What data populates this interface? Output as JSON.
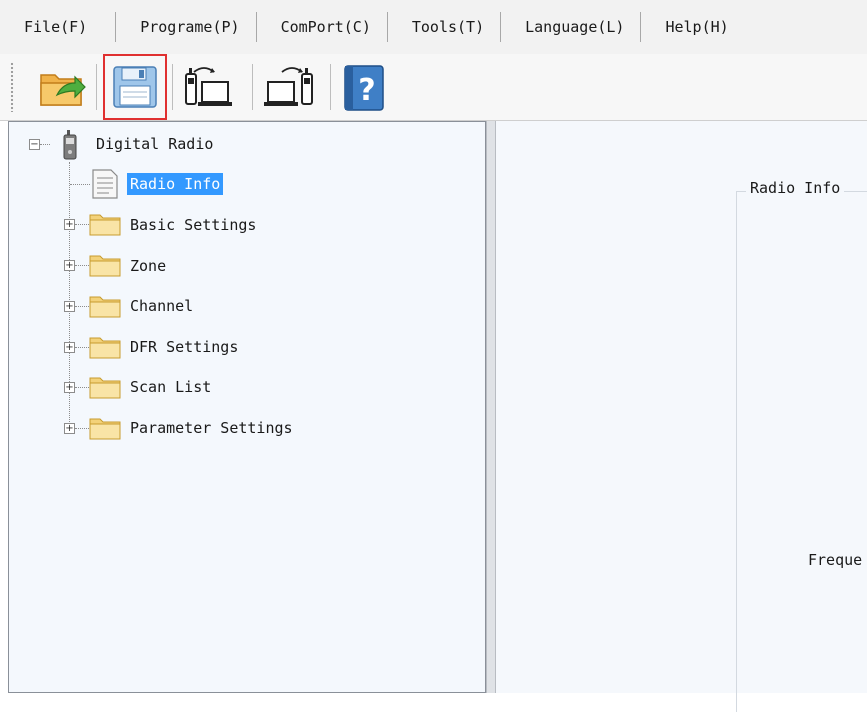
{
  "menu": [
    {
      "label": "File(F)"
    },
    {
      "label": "Programe(P)"
    },
    {
      "label": "ComPort(C)"
    },
    {
      "label": "Tools(T)"
    },
    {
      "label": "Language(L)"
    },
    {
      "label": "Help(H)"
    }
  ],
  "toolbar": {
    "buttons": [
      {
        "icon": "open-folder-icon"
      },
      {
        "icon": "save-icon"
      },
      {
        "icon": "read-from-radio-icon"
      },
      {
        "icon": "write-to-radio-icon"
      },
      {
        "icon": "help-icon"
      }
    ]
  },
  "tree": {
    "root": "Digital Radio",
    "items": [
      {
        "label": "Radio Info"
      },
      {
        "label": "Basic Settings"
      },
      {
        "label": "Zone"
      },
      {
        "label": "Channel"
      },
      {
        "label": "DFR Settings"
      },
      {
        "label": "Scan List"
      },
      {
        "label": "Parameter Settings"
      }
    ],
    "expander_collapsed": "+",
    "expander_expanded": "−"
  },
  "content": {
    "group_title": "Radio Info",
    "freq_label": "Freque"
  },
  "colors": {
    "selection": "#3399ff",
    "highlight_border": "#e03030"
  }
}
